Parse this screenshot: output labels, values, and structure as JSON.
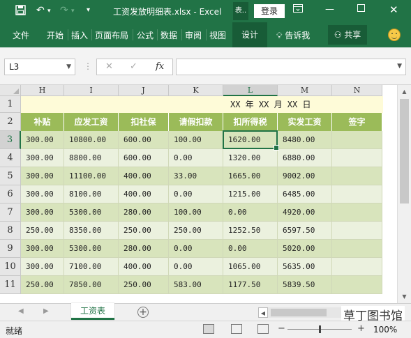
{
  "titlebar": {
    "title": "工资发放明细表.xlsx - Excel",
    "context_label": "表..",
    "login_label": "登录",
    "icons": [
      "save-icon",
      "undo-icon",
      "redo-icon",
      "customize-icon",
      "ribbon-display-icon",
      "minimize-icon",
      "maximize-icon",
      "close-icon"
    ]
  },
  "ribbon": {
    "tabs": [
      "文件",
      "开始",
      "插入",
      "页面布局",
      "公式",
      "数据",
      "审阅",
      "视图"
    ],
    "context_tab": "设计",
    "tell_me": "告诉我",
    "share": "共享"
  },
  "formula_bar": {
    "name_box": "L3",
    "formula_value": ""
  },
  "columns": [
    "H",
    "I",
    "J",
    "K",
    "L",
    "M",
    "N"
  ],
  "selected_column": "L",
  "row_numbers": [
    "1",
    "2",
    "3",
    "4",
    "5",
    "6",
    "7",
    "8",
    "9",
    "10",
    "11"
  ],
  "selected_row": "3",
  "sheet": {
    "title_row": "XX 年 XX 月 XX 日",
    "headers": [
      "补贴",
      "应发工资",
      "扣社保",
      "请假扣款",
      "扣所得税",
      "实发工资",
      "签字"
    ],
    "rows": [
      [
        "300.00",
        "10800.00",
        "600.00",
        "100.00",
        "1620.00",
        "8480.00",
        ""
      ],
      [
        "300.00",
        "8800.00",
        "600.00",
        "0.00",
        "1320.00",
        "6880.00",
        ""
      ],
      [
        "300.00",
        "11100.00",
        "400.00",
        "33.00",
        "1665.00",
        "9002.00",
        ""
      ],
      [
        "300.00",
        "8100.00",
        "400.00",
        "0.00",
        "1215.00",
        "6485.00",
        ""
      ],
      [
        "300.00",
        "5300.00",
        "280.00",
        "100.00",
        "0.00",
        "4920.00",
        ""
      ],
      [
        "250.00",
        "8350.00",
        "250.00",
        "250.00",
        "1252.50",
        "6597.50",
        ""
      ],
      [
        "300.00",
        "5300.00",
        "280.00",
        "0.00",
        "0.00",
        "5020.00",
        ""
      ],
      [
        "300.00",
        "7100.00",
        "400.00",
        "0.00",
        "1065.00",
        "5635.00",
        ""
      ],
      [
        "250.00",
        "7850.00",
        "250.00",
        "583.00",
        "1177.50",
        "5839.50",
        ""
      ]
    ]
  },
  "sheet_tabs": [
    "工资表"
  ],
  "watermark": "草丁图书馆",
  "status": {
    "ready": "就绪",
    "zoom": "100%"
  },
  "colors": {
    "excel_green": "#217346",
    "header_green": "#9bbb59",
    "band_dark": "#d8e4bc",
    "band_light": "#ebf1de",
    "title_fill": "#fefbd8"
  }
}
